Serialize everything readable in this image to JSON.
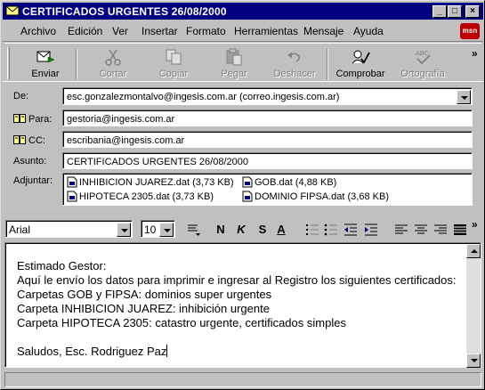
{
  "window": {
    "title": "CERTIFICADOS URGENTES 26/08/2000",
    "minimize_label": "_",
    "maximize_label": "□",
    "close_label": "×"
  },
  "menu": [
    {
      "label": "Archivo"
    },
    {
      "label": "Edición"
    },
    {
      "label": "Ver"
    },
    {
      "label": "Insertar"
    },
    {
      "label": "Formato"
    },
    {
      "label": "Herramientas"
    },
    {
      "label": "Mensaje"
    },
    {
      "label": "Ayuda"
    }
  ],
  "brand_logo_text": "msn",
  "toolbar": {
    "send": "Enviar",
    "cut": "Cortar",
    "copy": "Copiar",
    "paste": "Pegar",
    "undo": "Deshacer",
    "check": "Comprobar",
    "spelling": "Ortografía",
    "overflow": "»"
  },
  "header": {
    "from_label": "De:",
    "from_value": "esc.gonzalezmontalvo@ingesis.com.ar    (correo.ingesis.com.ar)",
    "to_label": "Para:",
    "to_value": "gestoria@ingesis.com.ar",
    "cc_label": "CC:",
    "cc_value": "escribania@ingesis.com.ar",
    "subject_label": "Asunto:",
    "subject_value": "CERTIFICADOS URGENTES 26/08/2000",
    "attach_label": "Adjuntar:"
  },
  "attachments": [
    {
      "name": "INHIBICION JUAREZ.dat (3,73 KB)"
    },
    {
      "name": "GOB.dat (4,88 KB)"
    },
    {
      "name": "HIPOTECA 2305.dat (3,73 KB)"
    },
    {
      "name": "DOMINIO FIPSA.dat (3,68 KB)"
    }
  ],
  "format": {
    "font": "Arial",
    "size": "10",
    "bold": "N",
    "italic": "K",
    "underline": "S",
    "color": "A",
    "overflow": "»"
  },
  "body": {
    "lines": [
      "Estimado Gestor:",
      "Aquí le envío los datos para imprimir e ingresar al Registro los siguientes certificados:",
      "Carpetas GOB y FIPSA: dominios super urgentes",
      "Carpeta INHIBICION JUAREZ: inhibición urgente",
      "Carpeta HIPOTECA 2305: catastro urgente, certificados simples",
      "",
      "Saludos, Esc. Rodriguez Paz"
    ]
  },
  "colors": {
    "titlebar": "#000080",
    "face": "#c0c0c0",
    "logo": "#c00000"
  }
}
